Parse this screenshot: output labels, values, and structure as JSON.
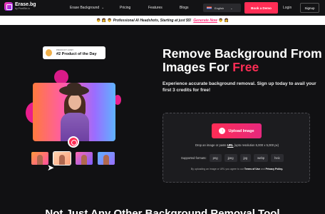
{
  "nav": {
    "logo_name": "Erase.bg",
    "logo_by": "by PixelBin.io",
    "items": [
      "Erase Background",
      "Pricing",
      "Features",
      "Blogs"
    ],
    "language": "English",
    "book_demo": "Book a Demo",
    "login": "Login",
    "signup": "Signup"
  },
  "banner": {
    "faces_left": "👨 👩 👨",
    "text": "Professional AI Headshots, Starting at just $5!",
    "cta": "Generate Now",
    "faces_right": "👨 👩"
  },
  "award": {
    "small": "PRODUCT HUNT",
    "title": "#2 Product of the Day"
  },
  "hero": {
    "title_main": "Remove Background From Images For ",
    "title_accent": "Free",
    "subtitle": "Experience accurate background removal. Sign up today to avail your first 3 credits for free!"
  },
  "upload": {
    "button": "Upload Image",
    "drop_prefix": "Drop an image or paste ",
    "drop_url": "URL",
    "drop_suffix": " (upto resolution 5,000 x 5,000 px)",
    "formats_label": "Supported formats:",
    "formats": [
      "png",
      "jpeg",
      "jpg",
      "webp",
      "heic"
    ],
    "terms_prefix": "By uploading an image or URL you agree to our ",
    "terms_link": "Terms of Use",
    "terms_mid": " and ",
    "privacy_link": "Privacy Policy."
  },
  "bottom": {
    "title": "Not Just Any Other Background Removal Tool"
  },
  "colors": {
    "accent": "#ff2d55",
    "background": "#111113"
  }
}
